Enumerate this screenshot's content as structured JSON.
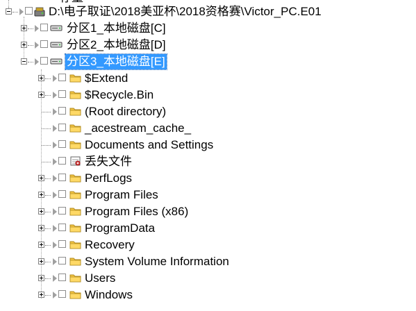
{
  "tree": {
    "top_partial_label": "存量",
    "root": {
      "label": "D:\\电子取证\\2018美亚杯\\2018资格赛\\Victor_PC.E01",
      "icon": "disk-image-icon"
    },
    "partitions": [
      {
        "label": "分区1_本地磁盘[C]",
        "icon": "drive-icon",
        "expanded": false,
        "selected": false
      },
      {
        "label": "分区2_本地磁盘[D]",
        "icon": "drive-icon",
        "expanded": false,
        "selected": false
      },
      {
        "label": "分区3_本地磁盘[E]",
        "icon": "drive-icon",
        "expanded": true,
        "selected": true
      }
    ],
    "children": [
      {
        "label": "$Extend",
        "icon": "folder-icon",
        "expandable": true
      },
      {
        "label": "$Recycle.Bin",
        "icon": "folder-icon",
        "expandable": true
      },
      {
        "label": "(Root directory)",
        "icon": "folder-icon",
        "expandable": false
      },
      {
        "label": "_acestream_cache_",
        "icon": "folder-icon",
        "expandable": false
      },
      {
        "label": "Documents and Settings",
        "icon": "folder-icon",
        "expandable": false
      },
      {
        "label": "丢失文件",
        "icon": "lost-files-icon",
        "expandable": false
      },
      {
        "label": "PerfLogs",
        "icon": "folder-icon",
        "expandable": true
      },
      {
        "label": "Program Files",
        "icon": "folder-icon",
        "expandable": true
      },
      {
        "label": "Program Files (x86)",
        "icon": "folder-icon",
        "expandable": true
      },
      {
        "label": "ProgramData",
        "icon": "folder-icon",
        "expandable": true
      },
      {
        "label": "Recovery",
        "icon": "folder-icon",
        "expandable": true
      },
      {
        "label": "System Volume Information",
        "icon": "folder-icon",
        "expandable": true
      },
      {
        "label": "Users",
        "icon": "folder-icon",
        "expandable": true
      },
      {
        "label": "Windows",
        "icon": "folder-icon",
        "expandable": true
      }
    ]
  },
  "colors": {
    "selection": "#3399ff",
    "folder": "#f5c542",
    "tree_line": "#a0a0a0"
  }
}
